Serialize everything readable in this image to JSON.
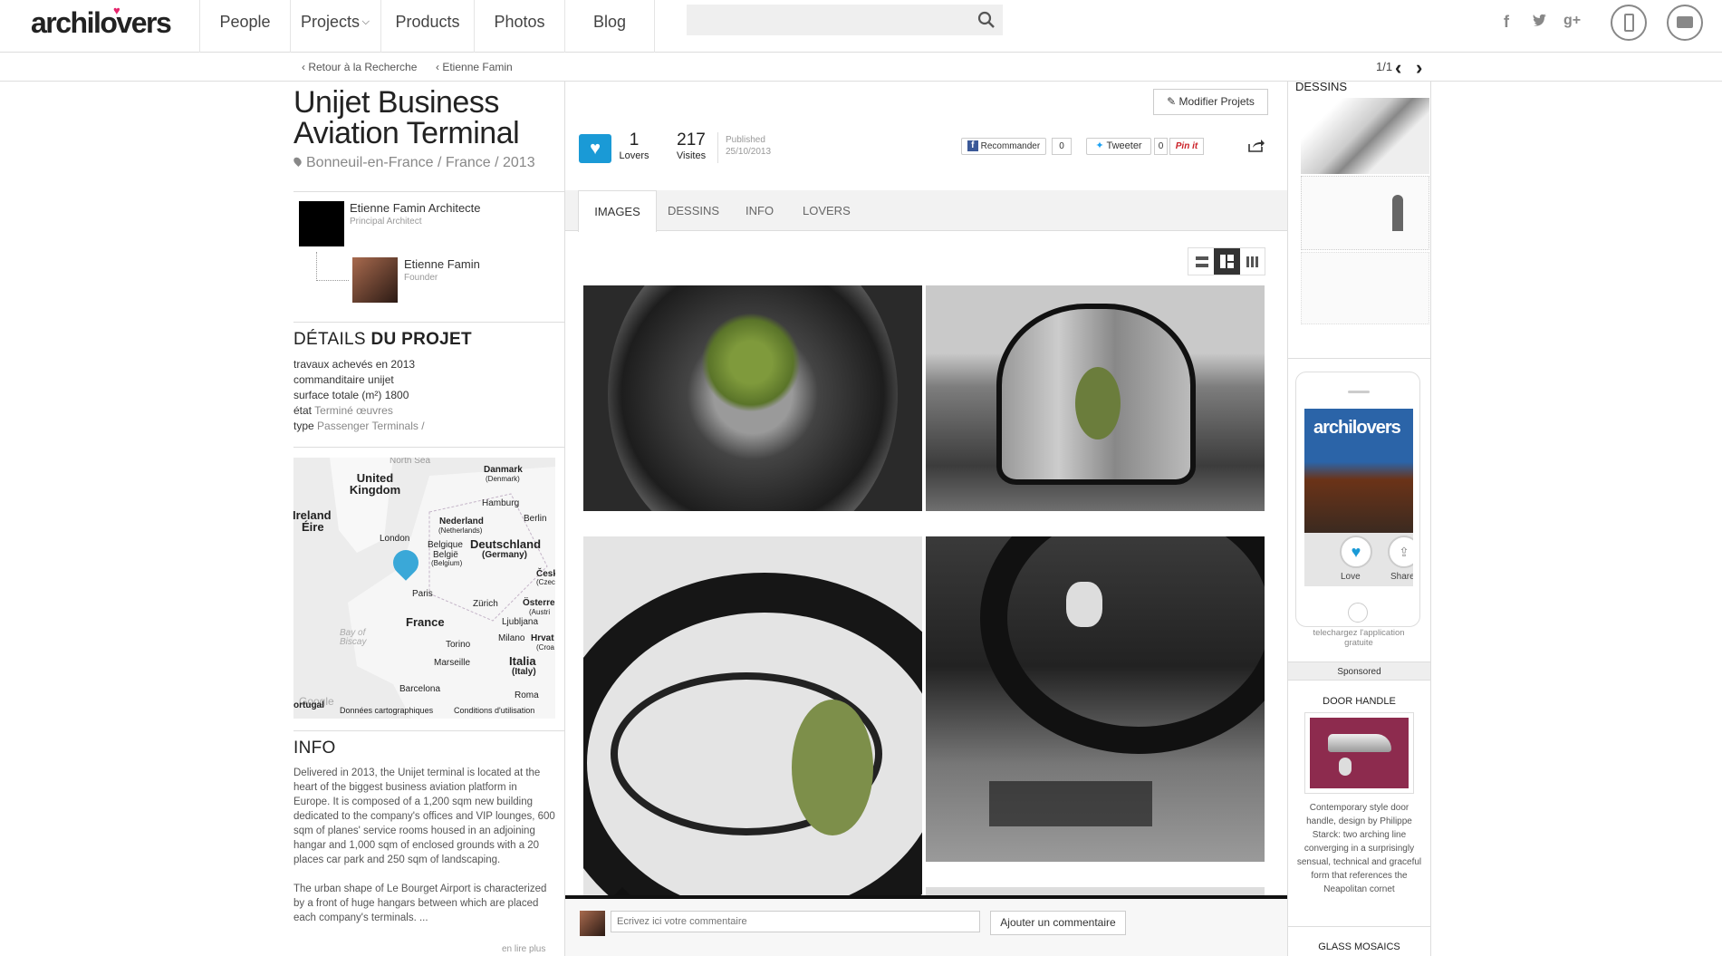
{
  "header": {
    "logo": "archilovers",
    "nav": [
      "People",
      "Projects",
      "Products",
      "Photos",
      "Blog"
    ],
    "search_placeholder": ""
  },
  "breadcrumb": {
    "back": "Retour à la Recherche",
    "author": "Etienne Famin",
    "pager": "1/1"
  },
  "project": {
    "title": "Unijet Business Aviation Terminal",
    "location": "Bonneuil-en-France / France / 2013",
    "architects": [
      {
        "name": "Etienne Famin Architecte",
        "role": "Principal Architect"
      },
      {
        "name": "Etienne Famin",
        "role": "Founder"
      }
    ]
  },
  "details": {
    "heading_a": "DÉTAILS",
    "heading_b": "DU PROJET",
    "rows": [
      {
        "k": "travaux achevés en",
        "v": "2013"
      },
      {
        "k": "commanditaire",
        "v": "unijet"
      },
      {
        "k": "surface totale (m²)",
        "v": "1800"
      },
      {
        "k": "état",
        "v": "Terminé œuvres"
      },
      {
        "k": "type",
        "v": "Passenger Terminals /"
      }
    ]
  },
  "map": {
    "labels": [
      "North Sea",
      "Danmark",
      "(Denmark)",
      "United Kingdom",
      "Hamburg",
      "Ireland",
      "Éire",
      "Nederland",
      "(Netherlands)",
      "Berlin",
      "London",
      "België",
      "Belgique",
      "(Belgium)",
      "Deutschland",
      "(Germany)",
      "Česk",
      "(Czec",
      "Paris",
      "Zürich",
      "Österre",
      "(Austri",
      "France",
      "Ljubljana",
      "Bay of",
      "Biscay",
      "Torino",
      "Milano",
      "Hrvat",
      "(Croa",
      "Marseille",
      "Italia",
      "(Italy)",
      "Barcelona",
      "Roma",
      "Google",
      "Données cartographiques",
      "Conditions d'utilisation",
      "ortugal"
    ]
  },
  "info": {
    "heading": "INFO",
    "p1": "Delivered in 2013, the Unijet terminal is located at the heart of the biggest business aviation platform in Europe. It is composed of a 1,200 sqm new building dedicated to the company's offices and VIP lounges, 600 sqm of planes' service rooms housed in an adjoining hangar and 1,000 sqm of enclosed grounds with a 20 places car park and 250 sqm of landscaping.",
    "p2": "The urban shape of Le Bourget Airport is characterized by a front of huge hangars between which are placed each company's terminals. ...",
    "more": "en lire plus"
  },
  "stats": {
    "edit": "Modifier Projets",
    "lovers": "1",
    "lovers_label": "Lovers",
    "visits": "217",
    "visits_label": "Visites",
    "published": "Published",
    "date": "25/10/2013",
    "fb": "Recommander",
    "fb_count": "0",
    "tw": "Tweeter",
    "tw_count": "0",
    "pin": "Pin it"
  },
  "tabs": [
    "IMAGES",
    "DESSINS",
    "INFO",
    "LOVERS"
  ],
  "comment": {
    "placeholder": "Ecrivez ici votre commentaire",
    "button": "Ajouter un commentaire"
  },
  "right": {
    "dessins": "DESSINS",
    "app_logo": "archilovers",
    "love": "Love",
    "share": "Share",
    "app_caption": "telechargez l'application gratuite",
    "sponsored": "Sponsored",
    "product": "DOOR HANDLE",
    "product_desc": "Contemporary style door handle, design by Philippe Starck: two arching line converging in a surprisingly sensual, technical and graceful form that references the Neapolitan cornet",
    "next": "GLASS MOSAICS"
  },
  "colors": {
    "accent": "#1a9ad6",
    "pink": "#e5246b"
  }
}
